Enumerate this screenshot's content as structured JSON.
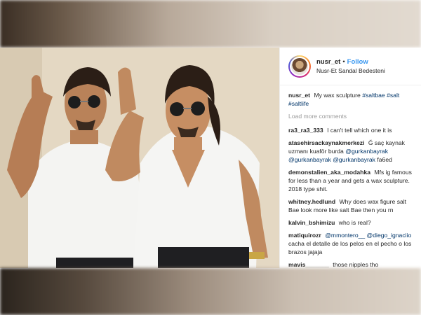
{
  "post": {
    "username": "nusr_et",
    "separator": "•",
    "follow_label": "Follow",
    "location": "Nusr-Et Sandal Bedesteni"
  },
  "caption": {
    "user": "nusr_et",
    "text": "My wax sculpture",
    "hashtags": [
      "#saltbae",
      "#salt",
      "#saltlife"
    ]
  },
  "load_more_label": "Load more comments",
  "comments": [
    {
      "user": "ra3_ra3_333",
      "text": "I can't tell which one it is"
    },
    {
      "user": "atasehirsackaynakmerkezi",
      "text": "Ğ saç kaynak uzmanı kuaför burda",
      "mentions": [
        "@gurkanbayrak",
        "@gurkanbayrak",
        "@gurkanbayrak"
      ],
      "suffix": "fa6ed"
    },
    {
      "user": "demonstalien_aka_modahka",
      "text": "Mfs ig famous for less than a year and gets a wax sculpture. 2018 type shit."
    },
    {
      "user": "whitney.hedlund",
      "text": "Why does wax figure salt Bae look more like salt Bae then you rn"
    },
    {
      "user": "kalvin_bshimizu",
      "text": "who is real?"
    },
    {
      "user": "matiquirozr",
      "mention": "@mmontero__",
      "mention2": "@diego_ignaciio",
      "text": "cacha el detalle de los pelos en el pecho o los brazos jajaja"
    },
    {
      "user": "mavis_______",
      "text": "those nipples tho"
    }
  ],
  "colors": {
    "link": "#3897f0",
    "hashtag": "#003569",
    "muted": "#999999",
    "text": "#262626"
  }
}
